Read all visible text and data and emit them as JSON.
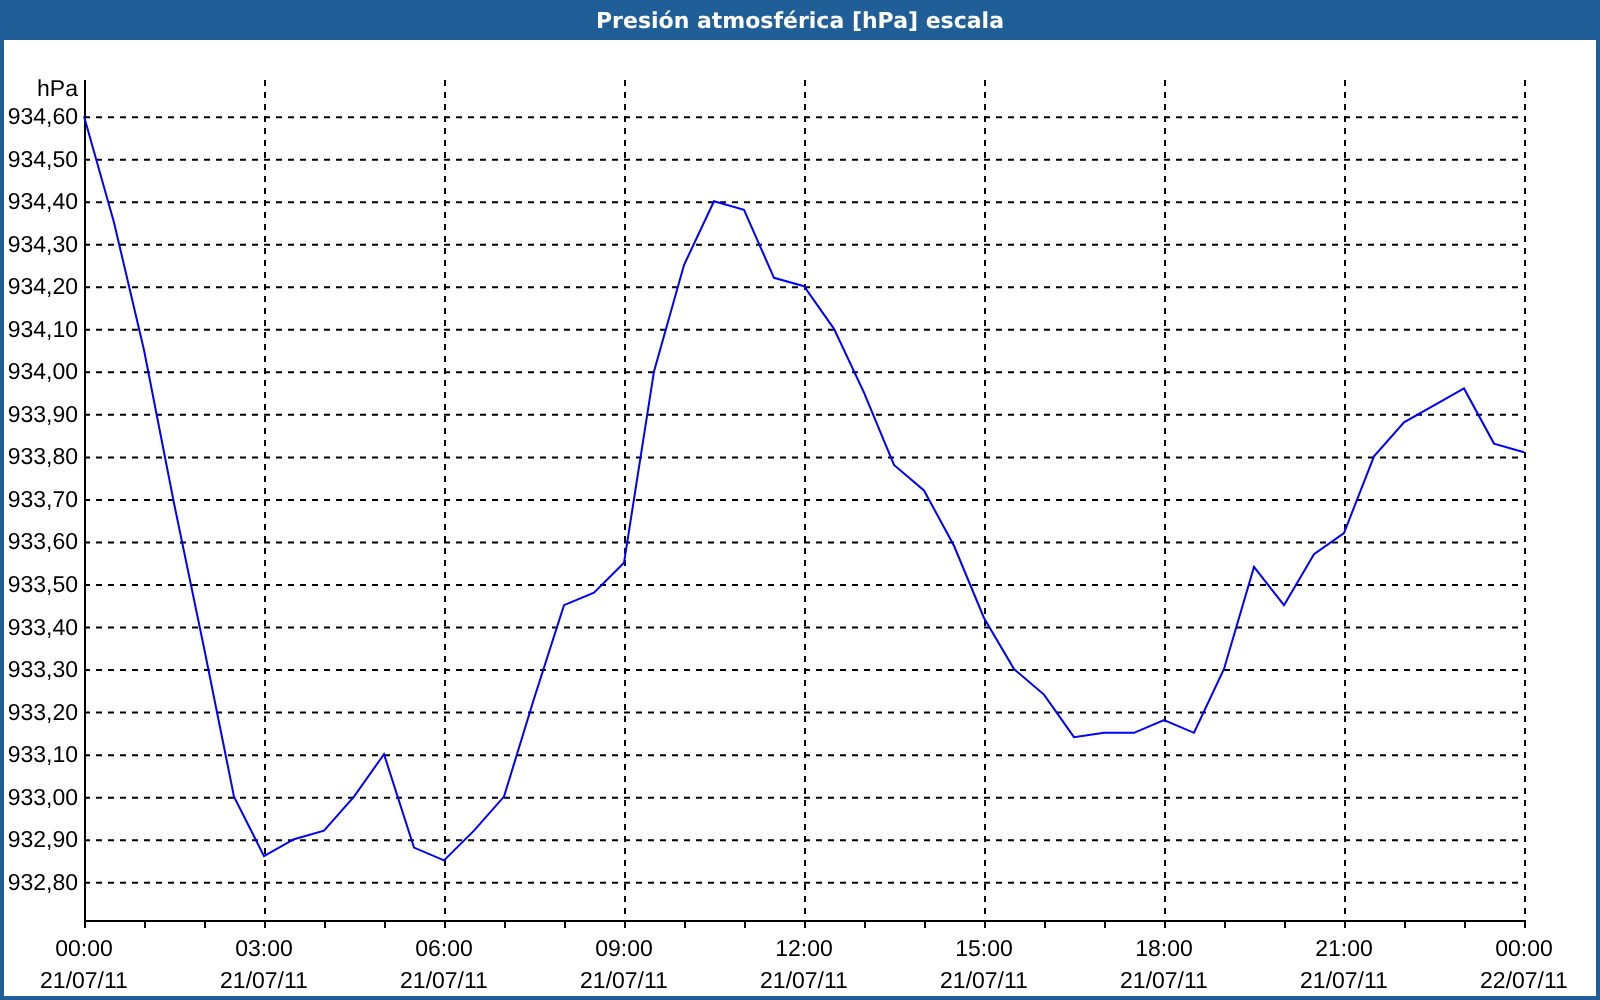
{
  "chart": {
    "chart_data": {
      "type": "line",
      "title": "Presión atmosférica [hPa] escala",
      "ylabel": "hPa",
      "grid": true,
      "ylim": [
        932.71,
        934.685
      ],
      "categories": [
        "00:00\n21/07/11",
        null,
        null,
        null,
        null,
        null,
        "03:00\n21/07/11",
        null,
        null,
        null,
        null,
        null,
        "06:00\n21/07/11",
        null,
        null,
        null,
        null,
        null,
        "09:00\n21/07/11",
        null,
        null,
        null,
        null,
        null,
        "12:00\n21/07/11",
        null,
        null,
        null,
        null,
        null,
        "15:00\n21/07/11",
        null,
        null,
        null,
        null,
        null,
        "18:00\n21/07/11",
        null,
        null,
        null,
        null,
        null,
        "21:00\n21/07/11",
        null,
        null,
        null,
        null,
        null,
        "00:00\n22/07/11"
      ],
      "yticks": [
        {
          "value": 932.8,
          "label": "932,80"
        },
        {
          "value": 932.9,
          "label": "932,90"
        },
        {
          "value": 933.0,
          "label": "933,00"
        },
        {
          "value": 933.1,
          "label": "933,10"
        },
        {
          "value": 933.2,
          "label": "933,20"
        },
        {
          "value": 933.3,
          "label": "933,30"
        },
        {
          "value": 933.4,
          "label": "933,40"
        },
        {
          "value": 933.5,
          "label": "933,50"
        },
        {
          "value": 933.6,
          "label": "933,60"
        },
        {
          "value": 933.7,
          "label": "933,70"
        },
        {
          "value": 933.8,
          "label": "933,80"
        },
        {
          "value": 933.9,
          "label": "933,90"
        },
        {
          "value": 934.0,
          "label": "934,00"
        },
        {
          "value": 934.1,
          "label": "934,10"
        },
        {
          "value": 934.2,
          "label": "934,20"
        },
        {
          "value": 934.3,
          "label": "934,30"
        },
        {
          "value": 934.4,
          "label": "934,40"
        },
        {
          "value": 934.5,
          "label": "934,50"
        },
        {
          "value": 934.6,
          "label": "934,60"
        }
      ],
      "series": [
        {
          "color": "#0000ff",
          "values": [
            934.6,
            934.35,
            934.05,
            933.69,
            933.35,
            933.0,
            932.86,
            932.9,
            932.92,
            933.0,
            933.1,
            932.88,
            932.85,
            932.92,
            933.0,
            933.23,
            933.45,
            933.48,
            933.55,
            934.0,
            934.25,
            934.4,
            934.38,
            934.22,
            934.2,
            934.1,
            933.95,
            933.78,
            933.72,
            933.59,
            933.42,
            933.3,
            933.24,
            933.14,
            933.15,
            933.15,
            933.18,
            933.15,
            933.3,
            933.54,
            933.45,
            933.57,
            933.62,
            933.8,
            933.88,
            933.92,
            933.96,
            933.83,
            933.81
          ]
        }
      ]
    }
  }
}
